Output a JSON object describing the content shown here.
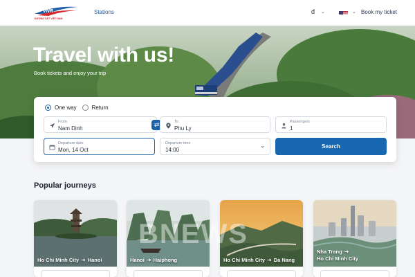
{
  "header": {
    "logo_text": "VNR",
    "logo_subtext": "ĐƯỜNG SẮT VIỆT NAM",
    "nav_stations": "Stations",
    "currency": "đ",
    "book_my_ticket": "Book my ticket",
    "flag_icon": "us-flag-icon"
  },
  "hero": {
    "title": "Travel with us!",
    "subtitle": "Book tickets and enjoy your trip"
  },
  "search": {
    "trip_types": [
      {
        "label": "One way",
        "selected": true
      },
      {
        "label": "Return",
        "selected": false
      }
    ],
    "from": {
      "label": "From",
      "value": "Nam Dinh"
    },
    "to": {
      "label": "To",
      "value": "Phu Ly"
    },
    "passengers": {
      "label": "Passengers",
      "value": "1"
    },
    "departure_date": {
      "label": "Departure date",
      "value": "Mon, 14 Oct"
    },
    "departure_time": {
      "label": "Departure time",
      "value": "14:00"
    },
    "search_button": "Search",
    "accent_color": "#1767b1"
  },
  "popular": {
    "title": "Popular journeys",
    "journeys": [
      {
        "from": "Ho Chi Minh City",
        "to": "Hanoi"
      },
      {
        "from": "Hanoi",
        "to": "Haiphong"
      },
      {
        "from": "Ho Chi Minh City",
        "to": "Da Nang"
      },
      {
        "from": "Nha Trang",
        "to": "Ho Chi Minh City"
      }
    ]
  },
  "watermark": "BNEWS"
}
